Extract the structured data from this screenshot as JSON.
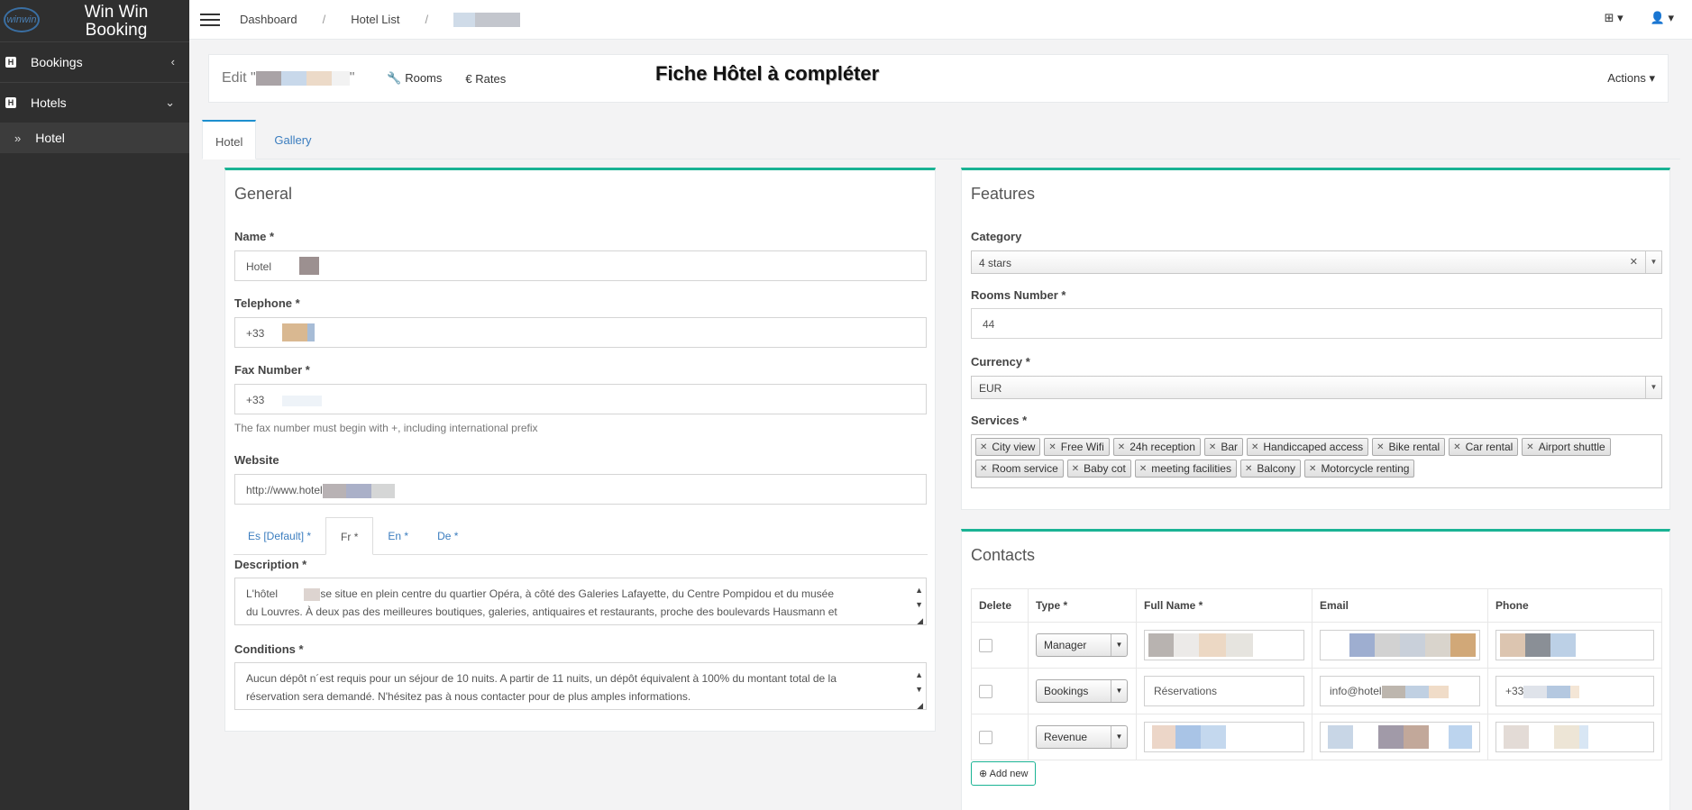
{
  "app": {
    "name": "Win Win Booking",
    "logo_text": "winwin"
  },
  "sidebar": {
    "items": [
      {
        "label": "Bookings",
        "icon": "calendar-h-icon"
      },
      {
        "label": "Hotels",
        "icon": "calendar-h-icon"
      }
    ],
    "sub_items": [
      {
        "label": "Hotel",
        "icon": "double-chevron-right-icon"
      }
    ]
  },
  "breadcrumb": {
    "dashboard": "Dashboard",
    "sep": "/",
    "hotel_list": "Hotel List"
  },
  "header": {
    "edit_prefix": "Edit \"",
    "edit_suffix": "\"",
    "rooms_icon": "🔧",
    "rooms": "Rooms",
    "rates_icon": "€",
    "rates": "Rates",
    "banner": "Fiche Hôtel à compléter",
    "actions": "Actions"
  },
  "tabs": [
    "Hotel",
    "Gallery"
  ],
  "general": {
    "title": "General",
    "name_label": "Name *",
    "name_value": "Hotel",
    "telephone_label": "Telephone *",
    "telephone_value": "+33",
    "fax_label": "Fax Number *",
    "fax_value": "+33",
    "fax_help": "The fax number must begin with +, including international prefix",
    "website_label": "Website",
    "website_value": "http://www.hotel",
    "lang_tabs": [
      "Es [Default] *",
      "Fr *",
      "En *",
      "De *"
    ],
    "description_label": "Description *",
    "description_pre": "L'hôtel",
    "description_line1": "se situe en plein centre du quartier Opéra, à côté des Galeries Lafayette, du Centre Pompidou et du musée",
    "description_line2": "du Louvres. À deux pas des meilleures boutiques, galeries, antiquaires et restaurants, proche des boulevards Hausmann et",
    "conditions_label": "Conditions *",
    "conditions_line1": "Aucun dépôt n´est requis pour un séjour de 10 nuits. A partir de 11 nuits, un dépôt équivalent à 100% du montant total de la",
    "conditions_line2": "réservation sera demandé. N'hésitez pas à nous contacter pour de plus amples informations."
  },
  "features": {
    "title": "Features",
    "category_label": "Category",
    "category_value": "4 stars",
    "rooms_label": "Rooms Number *",
    "rooms_value": "44",
    "currency_label": "Currency *",
    "currency_value": "EUR",
    "services_label": "Services *",
    "services": [
      "City view",
      "Free Wifi",
      "24h reception",
      "Bar",
      "Handiccaped access",
      "Bike rental",
      "Car rental",
      "Airport shuttle",
      "Room service",
      "Baby cot",
      "meeting facilities",
      "Balcony",
      "Motorcycle renting"
    ]
  },
  "contacts": {
    "title": "Contacts",
    "headers": [
      "Delete",
      "Type *",
      "Full Name *",
      "Email",
      "Phone"
    ],
    "rows": [
      {
        "type": "Manager",
        "full_name": "",
        "email": "",
        "phone": ""
      },
      {
        "type": "Bookings",
        "full_name": "Réservations",
        "email": "info@hotel",
        "phone": "+33"
      },
      {
        "type": "Revenue",
        "full_name": "",
        "email": "",
        "phone": ""
      }
    ],
    "add_new": "Add new"
  }
}
